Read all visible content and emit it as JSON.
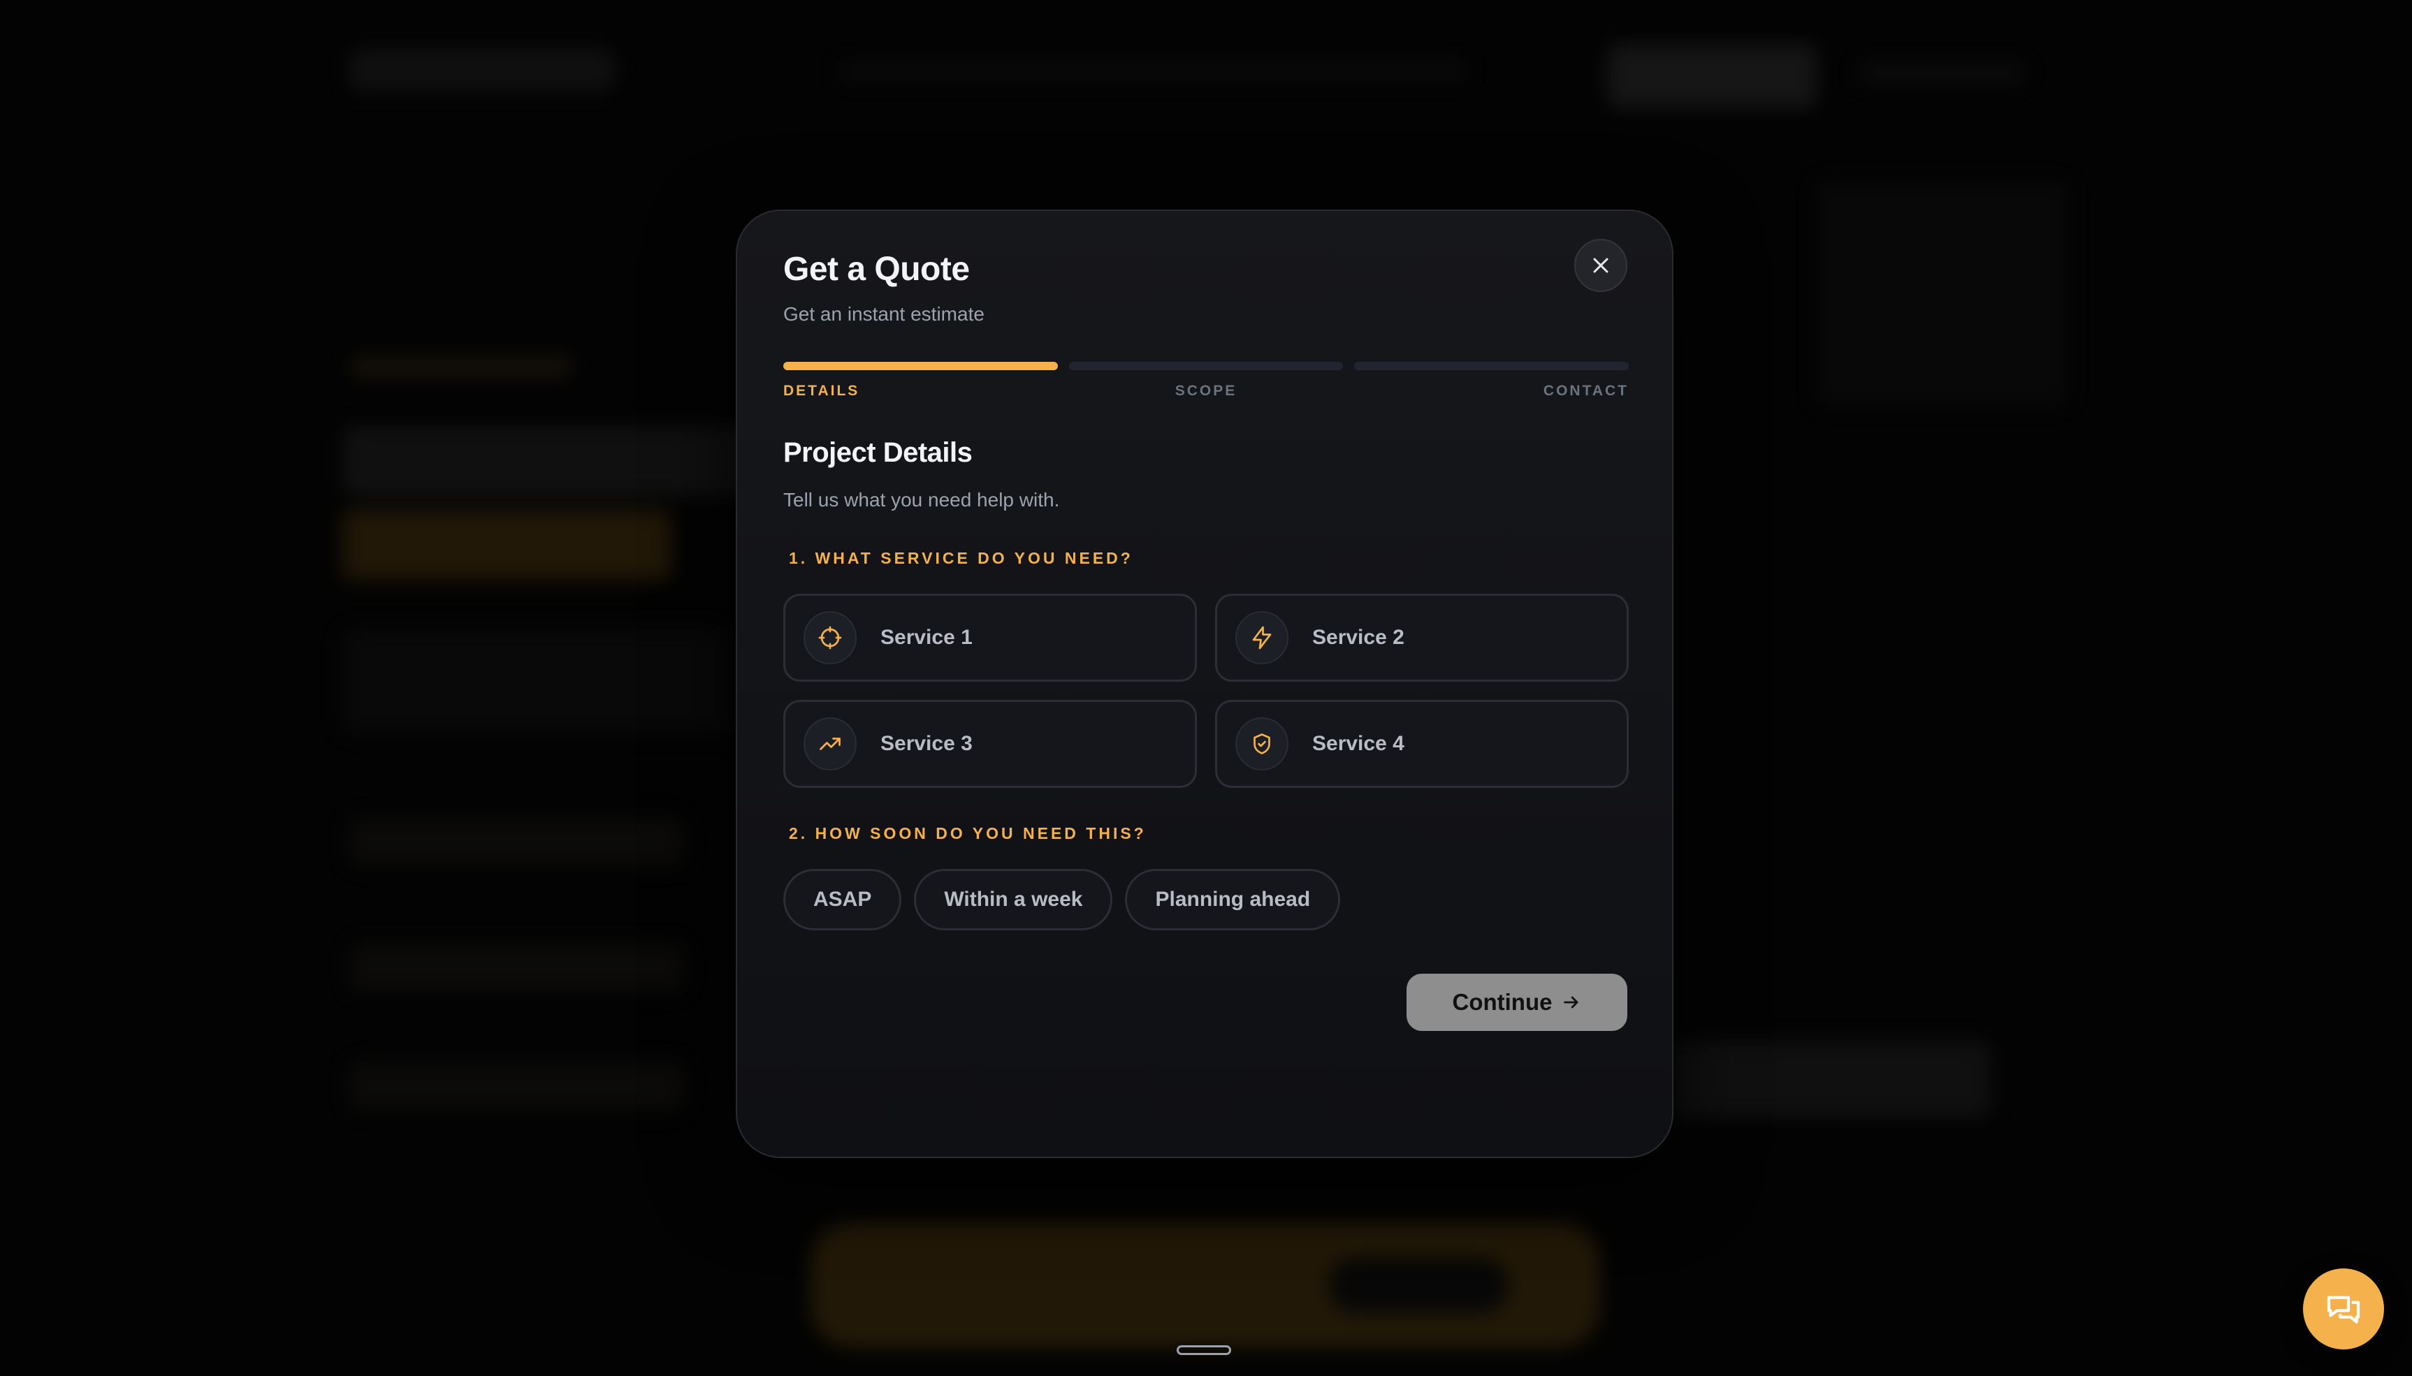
{
  "modal": {
    "title": "Get a Quote",
    "subtitle": "Get an instant estimate",
    "close_icon": "close-icon",
    "steps": [
      "DETAILS",
      "SCOPE",
      "CONTACT"
    ],
    "active_step": 1,
    "section_title": "Project Details",
    "section_desc": "Tell us what you need help with.",
    "question1": "1. WHAT SERVICE DO YOU NEED?",
    "services": [
      {
        "label": "Service 1",
        "icon": "crosshair-icon"
      },
      {
        "label": "Service 2",
        "icon": "lightning-icon"
      },
      {
        "label": "Service 3",
        "icon": "trending-up-icon"
      },
      {
        "label": "Service 4",
        "icon": "shield-icon"
      }
    ],
    "question2": "2. HOW SOON DO YOU NEED THIS?",
    "timelines": [
      "ASAP",
      "Within a week",
      "Planning ahead"
    ],
    "continue_label": "Continue",
    "continue_icon": "arrow-right-icon"
  },
  "chat_icon": "chat-icon",
  "colors": {
    "accent": "#f5b14c",
    "background": "#050505",
    "modal": "#16171b",
    "muted_text": "#9ca3af",
    "continue_button": "#8e8e8e"
  }
}
